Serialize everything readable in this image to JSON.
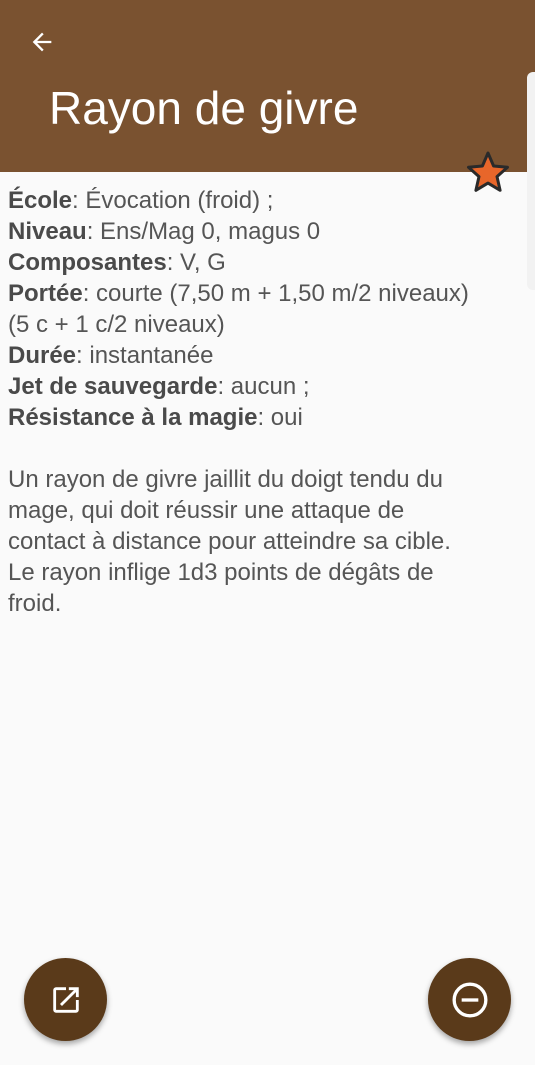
{
  "app_bar": {
    "title": "Rayon de givre",
    "back_icon": "arrow-left-icon",
    "favorite_icon": "star-icon",
    "color": "#7a5230"
  },
  "details": [
    {
      "label": "École",
      "value": ": Évocation (froid) ;"
    },
    {
      "label": "Niveau",
      "value": ": Ens/Mag 0, magus 0"
    },
    {
      "label": "Composantes",
      "value": ": V, G"
    },
    {
      "label": "Portée",
      "value": ": courte (7,50 m + 1,50 m/2 niveaux)"
    },
    {
      "label": "",
      "value": "(5 c + 1 c/2 niveaux)"
    },
    {
      "label": "Durée",
      "value": ": instantanée"
    },
    {
      "label": "Jet de sauvegarde",
      "value": ": aucun ;"
    },
    {
      "label": "Résistance à la magie",
      "value": ": oui"
    }
  ],
  "description": "Un rayon de givre jaillit du doigt tendu du mage, qui doit réussir une attaque de contact à distance pour atteindre sa cible. Le rayon inflige 1d3 points de dégâts de froid.",
  "fabs": {
    "left_icon": "open-external-icon",
    "right_icon": "remove-circle-icon",
    "color": "#5a3a1a"
  },
  "star_color": "#e8662a"
}
